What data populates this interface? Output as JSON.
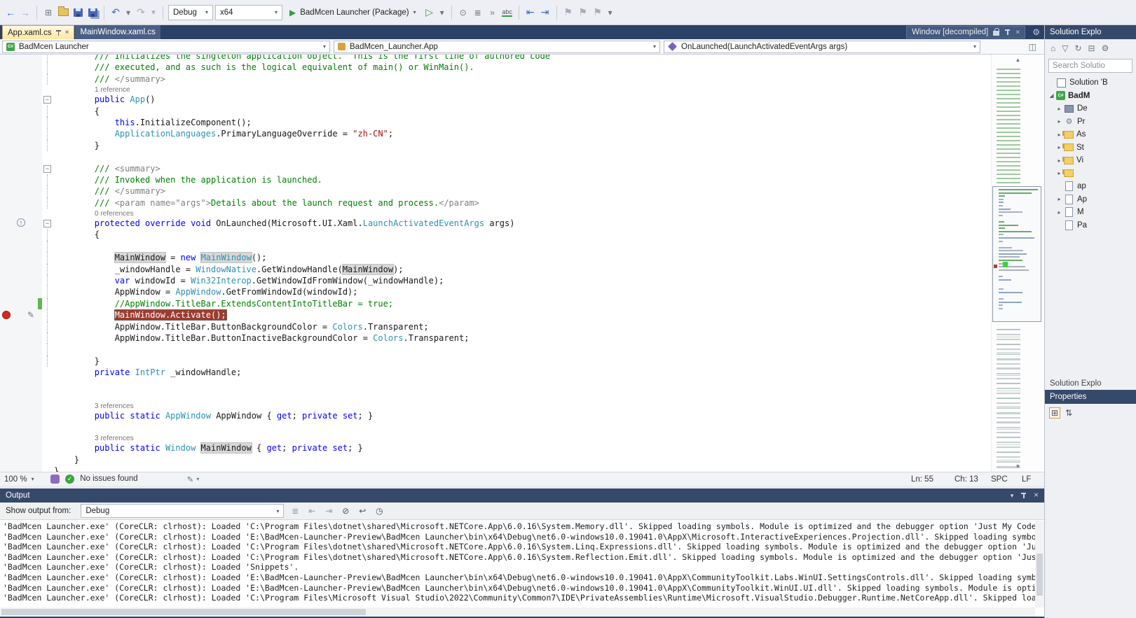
{
  "icons": {
    "back": "←",
    "forward": "→",
    "new": "⊞",
    "undo": "↶",
    "redo": "↷",
    "caret": "▾",
    "run": "▶",
    "run_outline": "▷",
    "close": "×",
    "gear": "⚙",
    "check": "✓",
    "scroll_up": "▲",
    "scroll_down": "▼",
    "collapsed": "▸",
    "expanded": "◢",
    "flag": "⚑",
    "clock": "◷",
    "home": "⌂",
    "refresh": "↻",
    "collapse_all": "⊟",
    "split": "◫",
    "filter": "▽",
    "pencil": "✎",
    "override": "↑",
    "list": "≣",
    "steps_back": "⇤",
    "steps_fwd": "⇥",
    "wrap": "↩",
    "clear": "⊘",
    "breakpoints": "⊙",
    "terminal": "»",
    "grid": "⊞",
    "sort": "⇅"
  },
  "toolbar": {
    "configuration": "Debug",
    "platform": "x64",
    "run_target": "BadMcen Launcher (Package)",
    "spell": "abc"
  },
  "tabs": {
    "active_label": "App.xaml.cs",
    "inactive_label": "MainWindow.xaml.cs",
    "preview_label": "Window [decompiled]"
  },
  "navbar": {
    "project": "BadMcen Launcher",
    "type": "BadMcen_Launcher.App",
    "member": "OnLaunched(LaunchActivatedEventArgs args)"
  },
  "editor": {
    "status": {
      "zoom": "100 %",
      "issues": "No issues found",
      "line": "Ln: 55",
      "ch": "Ch: 13",
      "spc": "SPC",
      "eol": "LF"
    },
    "rows": [
      {
        "k": "code",
        "ol": "line",
        "t": [
          [
            "c",
            "        /// Initializes the singleton application object.  This is the first line of authored code"
          ]
        ]
      },
      {
        "k": "code",
        "ol": "line",
        "t": [
          [
            "c",
            "        /// executed, and as such is the logical equivalent of main() or WinMain()."
          ]
        ]
      },
      {
        "k": "code",
        "ol": "line",
        "t": [
          [
            "c",
            "        /// "
          ],
          [
            "g",
            "</summary>"
          ]
        ]
      },
      {
        "k": "cl",
        "t": [
          [
            "cl",
            "1 reference"
          ]
        ]
      },
      {
        "k": "code",
        "ol": "box",
        "t": [
          [
            "k",
            "        public"
          ],
          [
            "p",
            " "
          ],
          [
            "t",
            "App"
          ],
          [
            "p",
            "()"
          ]
        ]
      },
      {
        "k": "code",
        "ol": "line",
        "t": [
          [
            "p",
            "        {"
          ]
        ]
      },
      {
        "k": "code",
        "ol": "line",
        "t": [
          [
            "k",
            "            this"
          ],
          [
            "p",
            ".InitializeComponent();"
          ]
        ]
      },
      {
        "k": "code",
        "ol": "line",
        "t": [
          [
            "t",
            "            ApplicationLanguages"
          ],
          [
            "p",
            ".PrimaryLanguageOverride = "
          ],
          [
            "s",
            "\"zh-CN\""
          ],
          [
            "p",
            ";"
          ]
        ]
      },
      {
        "k": "code",
        "ol": "line",
        "t": [
          [
            "p",
            "        }"
          ]
        ]
      },
      {
        "k": "blank"
      },
      {
        "k": "code",
        "ol": "box",
        "t": [
          [
            "c",
            "        /// "
          ],
          [
            "g",
            "<summary>"
          ]
        ]
      },
      {
        "k": "code",
        "ol": "line",
        "t": [
          [
            "c",
            "        /// Invoked when the application is launched."
          ]
        ]
      },
      {
        "k": "code",
        "ol": "line",
        "t": [
          [
            "c",
            "        /// "
          ],
          [
            "g",
            "</summary>"
          ]
        ]
      },
      {
        "k": "code",
        "ol": "line",
        "t": [
          [
            "c",
            "        /// "
          ],
          [
            "g",
            "<param name=\"args\">"
          ],
          [
            "c",
            "Details about the launch request and process."
          ],
          [
            "g",
            "</param>"
          ]
        ]
      },
      {
        "k": "cl",
        "t": [
          [
            "cl",
            "0 references"
          ]
        ]
      },
      {
        "k": "code",
        "ol": "box",
        "ovr": true,
        "t": [
          [
            "k",
            "        protected override void"
          ],
          [
            "p",
            " OnLaunched(Microsoft.UI.Xaml."
          ],
          [
            "t",
            "LaunchActivatedEventArgs"
          ],
          [
            "p",
            " args)"
          ]
        ]
      },
      {
        "k": "code",
        "ol": "line",
        "t": [
          [
            "p",
            "        {"
          ]
        ]
      },
      {
        "k": "blank",
        "ol": "line"
      },
      {
        "k": "code",
        "ol": "line",
        "t": [
          [
            "p",
            "            "
          ],
          [
            "h",
            "MainWindow"
          ],
          [
            "p",
            " = "
          ],
          [
            "k",
            "new"
          ],
          [
            "p",
            " "
          ],
          [
            "ht",
            "MainWindow"
          ],
          [
            "p",
            "();"
          ]
        ]
      },
      {
        "k": "code",
        "ol": "line",
        "t": [
          [
            "p",
            "            _windowHandle = "
          ],
          [
            "t",
            "WindowNative"
          ],
          [
            "p",
            ".GetWindowHandle("
          ],
          [
            "h",
            "MainWindow"
          ],
          [
            "p",
            ");"
          ]
        ]
      },
      {
        "k": "code",
        "ol": "line",
        "t": [
          [
            "k",
            "            var"
          ],
          [
            "p",
            " windowId = "
          ],
          [
            "t",
            "Win32Interop"
          ],
          [
            "p",
            ".GetWindowIdFromWindow(_windowHandle);"
          ]
        ]
      },
      {
        "k": "code",
        "ol": "line",
        "t": [
          [
            "p",
            "            AppWindow = "
          ],
          [
            "t",
            "AppWindow"
          ],
          [
            "p",
            ".GetFromWindowId(windowId);"
          ]
        ]
      },
      {
        "k": "code",
        "ol": "line",
        "chg": true,
        "t": [
          [
            "c",
            "            //AppWindow.TitleBar.ExtendsContentIntoTitleBar = true;"
          ]
        ]
      },
      {
        "k": "code",
        "ol": "line",
        "bp": true,
        "pencil": true,
        "t": [
          [
            "p",
            "            "
          ],
          [
            "bp",
            "MainWindow.Activate();"
          ]
        ]
      },
      {
        "k": "code",
        "ol": "line",
        "t": [
          [
            "p",
            "            AppWindow.TitleBar.ButtonBackgroundColor = "
          ],
          [
            "t",
            "Colors"
          ],
          [
            "p",
            ".Transparent;"
          ]
        ]
      },
      {
        "k": "code",
        "ol": "line",
        "t": [
          [
            "p",
            "            AppWindow.TitleBar.ButtonInactiveBackgroundColor = "
          ],
          [
            "t",
            "Colors"
          ],
          [
            "p",
            ".Transparent;"
          ]
        ]
      },
      {
        "k": "blank",
        "ol": "line"
      },
      {
        "k": "code",
        "ol": "line",
        "t": [
          [
            "p",
            "        }"
          ]
        ]
      },
      {
        "k": "code",
        "t": [
          [
            "k",
            "        private"
          ],
          [
            "p",
            " "
          ],
          [
            "t",
            "IntPtr"
          ],
          [
            "p",
            " _windowHandle;"
          ]
        ]
      },
      {
        "k": "blank"
      },
      {
        "k": "blank"
      },
      {
        "k": "cl",
        "t": [
          [
            "cl",
            "3 references"
          ]
        ]
      },
      {
        "k": "code",
        "t": [
          [
            "k",
            "        public static"
          ],
          [
            "p",
            " "
          ],
          [
            "t",
            "AppWindow"
          ],
          [
            "p",
            " AppWindow { "
          ],
          [
            "k",
            "get"
          ],
          [
            "p",
            "; "
          ],
          [
            "k",
            "private set"
          ],
          [
            "p",
            "; }"
          ]
        ]
      },
      {
        "k": "blank"
      },
      {
        "k": "cl",
        "t": [
          [
            "cl",
            "3 references"
          ]
        ]
      },
      {
        "k": "code",
        "t": [
          [
            "k",
            "        public static"
          ],
          [
            "p",
            " "
          ],
          [
            "t",
            "Window"
          ],
          [
            "p",
            " "
          ],
          [
            "h",
            "MainWindow"
          ],
          [
            "p",
            " { "
          ],
          [
            "k",
            "get"
          ],
          [
            "p",
            "; "
          ],
          [
            "k",
            "private set"
          ],
          [
            "p",
            "; }"
          ]
        ]
      },
      {
        "k": "code",
        "t": [
          [
            "p",
            "    }"
          ]
        ]
      },
      {
        "k": "code",
        "t": [
          [
            "p",
            "}"
          ]
        ]
      }
    ]
  },
  "output": {
    "title": "Output",
    "show_from_label": "Show output from:",
    "source": "Debug",
    "lines": [
      "'BadMcen Launcher.exe' (CoreCLR: clrhost): Loaded 'C:\\Program Files\\dotnet\\shared\\Microsoft.NETCore.App\\6.0.16\\System.Memory.dll'. Skipped loading symbols. Module is optimized and the debugger option 'Just My Code' is enabled.",
      "'BadMcen Launcher.exe' (CoreCLR: clrhost): Loaded 'E:\\BadMcen-Launcher-Preview\\BadMcen Launcher\\bin\\x64\\Debug\\net6.0-windows10.0.19041.0\\AppX\\Microsoft.InteractiveExperiences.Projection.dll'. Skipped loading symbols. Module is optimized and the debugger option 'Just My Code' is enabled.",
      "'BadMcen Launcher.exe' (CoreCLR: clrhost): Loaded 'C:\\Program Files\\dotnet\\shared\\Microsoft.NETCore.App\\6.0.16\\System.Linq.Expressions.dll'. Skipped loading symbols. Module is optimized and the debugger option 'Just My Code' is enabled.",
      "'BadMcen Launcher.exe' (CoreCLR: clrhost): Loaded 'C:\\Program Files\\dotnet\\shared\\Microsoft.NETCore.App\\6.0.16\\System.Reflection.Emit.dll'. Skipped loading symbols. Module is optimized and the debugger option 'Just My Code' is enabled.",
      "'BadMcen Launcher.exe' (CoreCLR: clrhost): Loaded 'Snippets'.",
      "'BadMcen Launcher.exe' (CoreCLR: clrhost): Loaded 'E:\\BadMcen-Launcher-Preview\\BadMcen Launcher\\bin\\x64\\Debug\\net6.0-windows10.0.19041.0\\AppX\\CommunityToolkit.Labs.WinUI.SettingsControls.dll'. Skipped loading symbols. Module is optimized and the debugger option 'Just My Code' is enabled.",
      "'BadMcen Launcher.exe' (CoreCLR: clrhost): Loaded 'E:\\BadMcen-Launcher-Preview\\BadMcen Launcher\\bin\\x64\\Debug\\net6.0-windows10.0.19041.0\\AppX\\CommunityToolkit.WinUI.UI.dll'. Skipped loading symbols. Module is optimized and the debugger option 'Just My Code' is enabled.",
      "'BadMcen Launcher.exe' (CoreCLR: clrhost): Loaded 'C:\\Program Files\\Microsoft Visual Studio\\2022\\Community\\Common7\\IDE\\PrivateAssemblies\\Runtime\\Microsoft.VisualStudio.Debugger.Runtime.NetCoreApp.dll'. Skipped loading symbols."
    ]
  },
  "solution_explorer": {
    "title": "Solution Explo",
    "search_placeholder": "Search Solutio",
    "bottom_tab_label": "Solution Explo",
    "properties_title": "Properties",
    "items": [
      {
        "arrow": "",
        "icon": "sln",
        "label": "Solution 'B",
        "indent": 0,
        "bold": false
      },
      {
        "arrow": "v",
        "icon": "proj",
        "label": "BadM",
        "indent": 0,
        "bold": true
      },
      {
        "arrow": ">",
        "icon": "dep",
        "label": "De",
        "indent": 1,
        "bold": false
      },
      {
        "arrow": ">",
        "icon": "gear",
        "label": "Pr",
        "indent": 1,
        "bold": false
      },
      {
        "arrow": ">",
        "icon": "folder",
        "label": "As",
        "indent": 1,
        "bold": false
      },
      {
        "arrow": ">",
        "icon": "folder",
        "label": "St",
        "indent": 1,
        "bold": false
      },
      {
        "arrow": ">",
        "icon": "folder",
        "label": "Vi",
        "indent": 1,
        "bold": false
      },
      {
        "arrow": ">",
        "icon": "folder",
        "label": "",
        "indent": 1,
        "bold": false
      },
      {
        "arrow": "",
        "icon": "doc",
        "label": "ap",
        "indent": 1,
        "bold": false
      },
      {
        "arrow": ">",
        "icon": "doc",
        "label": "Ap",
        "indent": 1,
        "bold": false
      },
      {
        "arrow": ">",
        "icon": "doc",
        "label": "M",
        "indent": 1,
        "bold": false
      },
      {
        "arrow": "",
        "icon": "doc",
        "label": "Pa",
        "indent": 1,
        "bold": false
      }
    ]
  }
}
